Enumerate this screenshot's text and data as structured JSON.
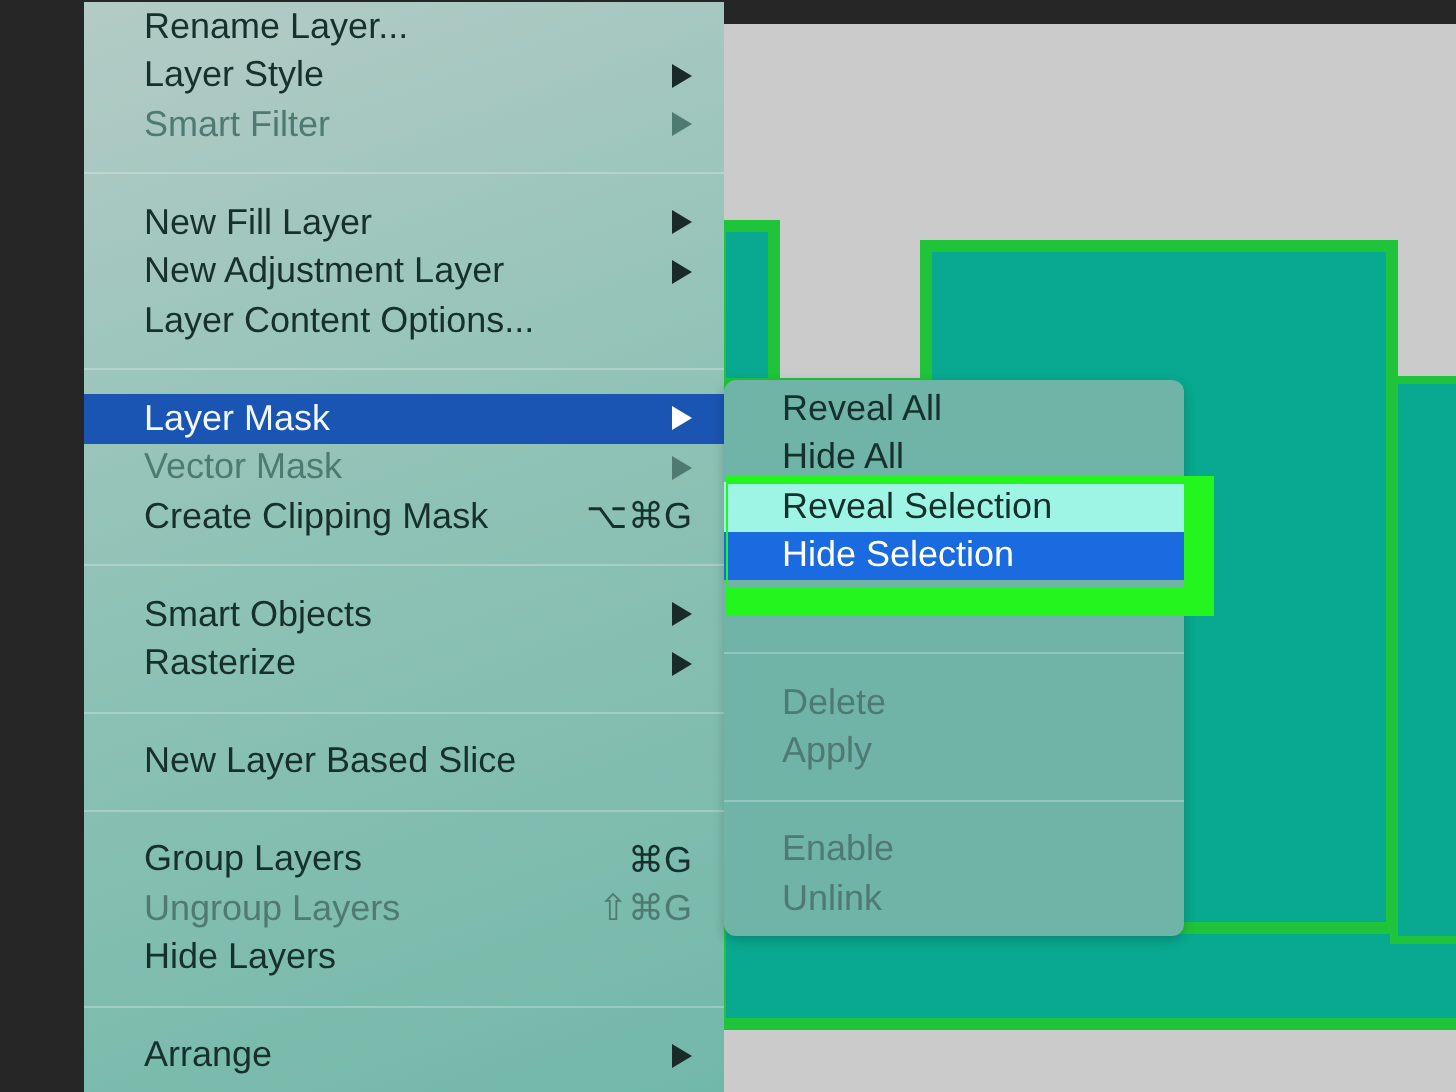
{
  "menu": {
    "items": [
      {
        "kind": "item",
        "label": "Rename Layer...",
        "disabled": false,
        "selected": false,
        "has_submenu": false
      },
      {
        "kind": "item",
        "label": "Layer Style",
        "disabled": false,
        "selected": false,
        "has_submenu": true
      },
      {
        "kind": "item",
        "label": "Smart Filter",
        "disabled": true,
        "selected": false,
        "has_submenu": true
      },
      {
        "kind": "separator"
      },
      {
        "kind": "item",
        "label": "New Fill Layer",
        "disabled": false,
        "selected": false,
        "has_submenu": true
      },
      {
        "kind": "item",
        "label": "New Adjustment Layer",
        "disabled": false,
        "selected": false,
        "has_submenu": true
      },
      {
        "kind": "item",
        "label": "Layer Content Options...",
        "disabled": false,
        "selected": false,
        "has_submenu": false
      },
      {
        "kind": "separator"
      },
      {
        "kind": "item",
        "label": "Layer Mask",
        "disabled": false,
        "selected": true,
        "has_submenu": true
      },
      {
        "kind": "item",
        "label": "Vector Mask",
        "disabled": true,
        "selected": false,
        "has_submenu": true
      },
      {
        "kind": "item",
        "label": "Create Clipping Mask",
        "shortcut": "⌥⌘G",
        "disabled": false,
        "selected": false,
        "has_submenu": false
      },
      {
        "kind": "separator"
      },
      {
        "kind": "item",
        "label": "Smart Objects",
        "disabled": false,
        "selected": false,
        "has_submenu": true
      },
      {
        "kind": "item",
        "label": "Rasterize",
        "disabled": false,
        "selected": false,
        "has_submenu": true
      },
      {
        "kind": "separator"
      },
      {
        "kind": "item",
        "label": "New Layer Based Slice",
        "disabled": false,
        "selected": false,
        "has_submenu": false
      },
      {
        "kind": "separator"
      },
      {
        "kind": "item",
        "label": "Group Layers",
        "shortcut": "⌘G",
        "disabled": false,
        "selected": false,
        "has_submenu": false
      },
      {
        "kind": "item",
        "label": "Ungroup Layers",
        "shortcut": "⇧⌘G",
        "disabled": true,
        "selected": false,
        "has_submenu": false
      },
      {
        "kind": "item",
        "label": "Hide Layers",
        "disabled": false,
        "selected": false,
        "has_submenu": false
      },
      {
        "kind": "separator"
      },
      {
        "kind": "item",
        "label": "Arrange",
        "disabled": false,
        "selected": false,
        "has_submenu": true
      }
    ]
  },
  "submenu": {
    "items": [
      {
        "kind": "item",
        "label": "Reveal All",
        "disabled": false,
        "selected": false,
        "highlighted": false
      },
      {
        "kind": "item",
        "label": "Hide All",
        "disabled": false,
        "selected": false,
        "highlighted": false
      },
      {
        "kind": "item",
        "label": "Reveal Selection",
        "disabled": false,
        "selected": false,
        "highlighted": true
      },
      {
        "kind": "item",
        "label": "Hide Selection",
        "disabled": false,
        "selected": true,
        "highlighted": false
      },
      {
        "kind": "hidden"
      },
      {
        "kind": "separator"
      },
      {
        "kind": "item",
        "label": "Delete",
        "disabled": true,
        "selected": false,
        "highlighted": false
      },
      {
        "kind": "item",
        "label": "Apply",
        "disabled": true,
        "selected": false,
        "highlighted": false
      },
      {
        "kind": "separator"
      },
      {
        "kind": "item",
        "label": "Enable",
        "disabled": true,
        "selected": false,
        "highlighted": false
      },
      {
        "kind": "item",
        "label": "Unlink",
        "disabled": true,
        "selected": false,
        "highlighted": false
      }
    ]
  }
}
